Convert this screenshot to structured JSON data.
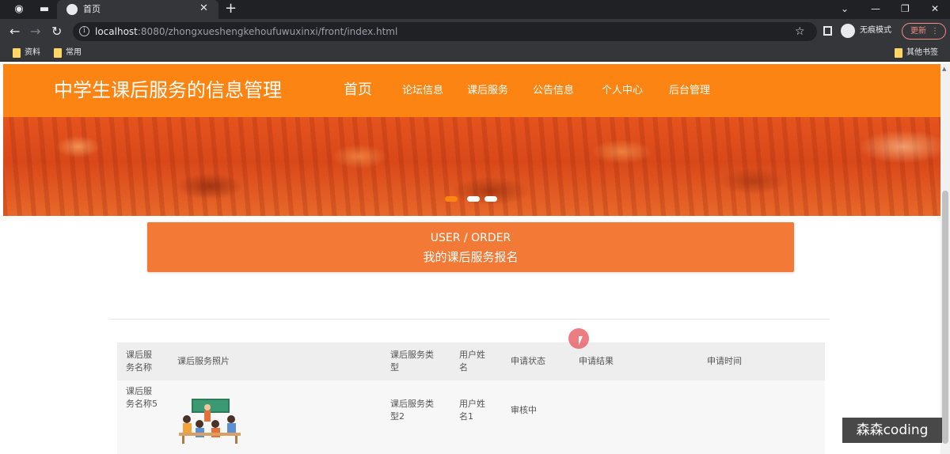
{
  "browser": {
    "tab_title": "首页",
    "url_host": "localhost",
    "url_rest": ":8080/zhongxueshengkehoufuwuxinxi/front/index.html",
    "incognito_label": "无痕模式",
    "update_label": "更新",
    "bookmarks": [
      "资料",
      "常用"
    ],
    "other_bookmarks": "其他书签"
  },
  "site": {
    "title": "中学生课后服务的信息管理",
    "nav": [
      "首页",
      "论坛信息",
      "课后服务",
      "公告信息",
      "个人中心",
      "后台管理"
    ]
  },
  "banner": {
    "slides": 3,
    "active_slide": 1
  },
  "order_section": {
    "title_en": "USER / ORDER",
    "title_cn": "我的课后服务报名"
  },
  "table": {
    "headers": [
      "课后服务名称",
      "课后服务照片",
      "课后服务类型",
      "用户姓名",
      "申请状态",
      "申请结果",
      "申请时间"
    ],
    "rows": [
      {
        "name": "课后服务名称5",
        "photo": "classroom-illustration",
        "type": "课后服务类型2",
        "user": "用户姓名1",
        "status": "审核中",
        "result": "",
        "time": ""
      }
    ]
  },
  "watermark": "森森coding"
}
